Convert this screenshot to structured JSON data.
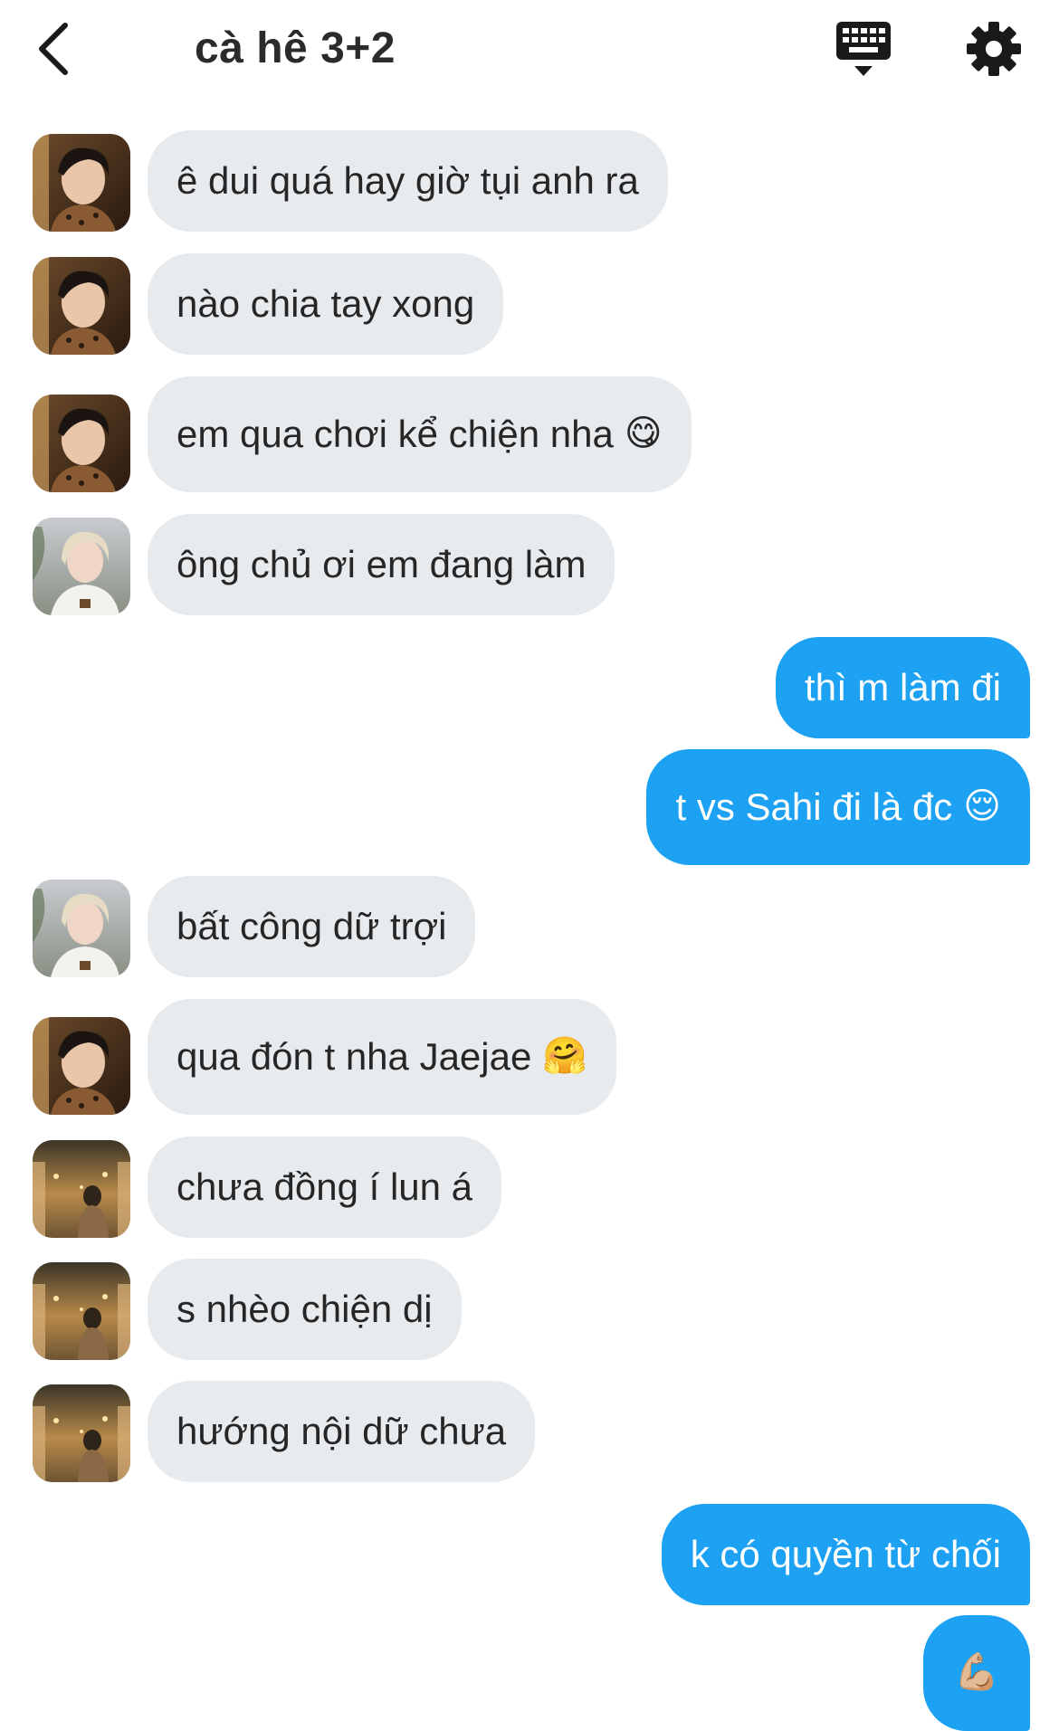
{
  "header": {
    "title": "cà hê 3+2"
  },
  "messages": [
    {
      "text": "ê dui quá hay giờ tụi anh ra",
      "emoji": ""
    },
    {
      "text": "nào chia tay xong",
      "emoji": ""
    },
    {
      "text": "em qua chơi kể chiện nha",
      "emoji": "😋"
    },
    {
      "text": "ông chủ ơi em đang làm",
      "emoji": ""
    },
    {
      "text": "thì m làm đi",
      "emoji": ""
    },
    {
      "text": "t vs Sahi đi là đc",
      "emoji": "😌"
    },
    {
      "text": "bất công dữ trợi",
      "emoji": ""
    },
    {
      "text": "qua đón t nha Jaejae",
      "emoji": "🤗"
    },
    {
      "text": "chưa đồng í lun á",
      "emoji": ""
    },
    {
      "text": "s nhèo chiện dị",
      "emoji": ""
    },
    {
      "text": "hướng nội dữ chưa",
      "emoji": ""
    },
    {
      "text": "k có quyền từ chối",
      "emoji": ""
    },
    {
      "text": "",
      "emoji": "💪🏼"
    }
  ],
  "colors": {
    "incoming_bubble": "#e8ebee",
    "outgoing_bubble": "#1da1f2",
    "icon": "#1a1a1a"
  },
  "icons": {
    "back": "chevron-left-icon",
    "keyboard": "keyboard-icon",
    "settings": "gear-icon"
  }
}
